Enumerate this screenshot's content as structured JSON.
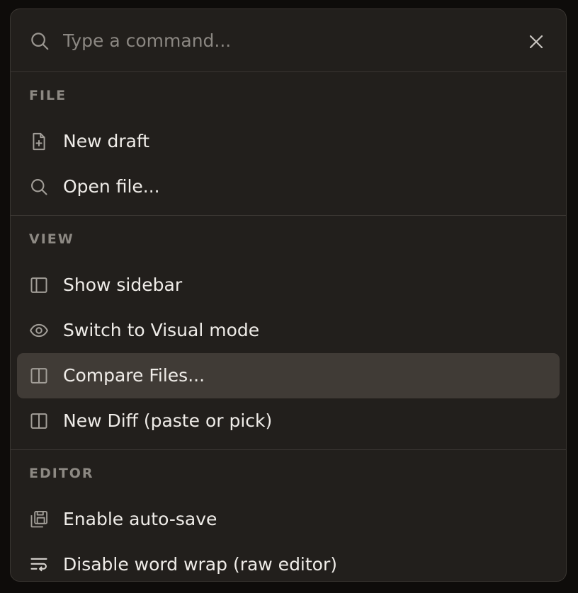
{
  "search": {
    "placeholder": "Type a command...",
    "value": ""
  },
  "icons": {
    "search": "search-icon",
    "close": "close-icon"
  },
  "colors": {
    "panel_bg": "#221f1c",
    "active_item_bg": "#403b36",
    "text": "#efece8",
    "muted_text": "#8d8983",
    "divider": "#3a3632"
  },
  "sections": [
    {
      "title": "FILE",
      "items": [
        {
          "label": "New draft",
          "icon": "file-plus-icon"
        },
        {
          "label": "Open file...",
          "icon": "search-icon"
        }
      ]
    },
    {
      "title": "VIEW",
      "items": [
        {
          "label": "Show sidebar",
          "icon": "sidebar-icon"
        },
        {
          "label": "Switch to Visual mode",
          "icon": "eye-icon"
        },
        {
          "label": "Compare Files...",
          "icon": "columns-icon",
          "active": true
        },
        {
          "label": "New Diff (paste or pick)",
          "icon": "columns-icon"
        }
      ]
    },
    {
      "title": "EDITOR",
      "items": [
        {
          "label": "Enable auto-save",
          "icon": "save-stack-icon"
        },
        {
          "label": "Disable word wrap (raw editor)",
          "icon": "wrap-text-icon"
        }
      ]
    }
  ]
}
